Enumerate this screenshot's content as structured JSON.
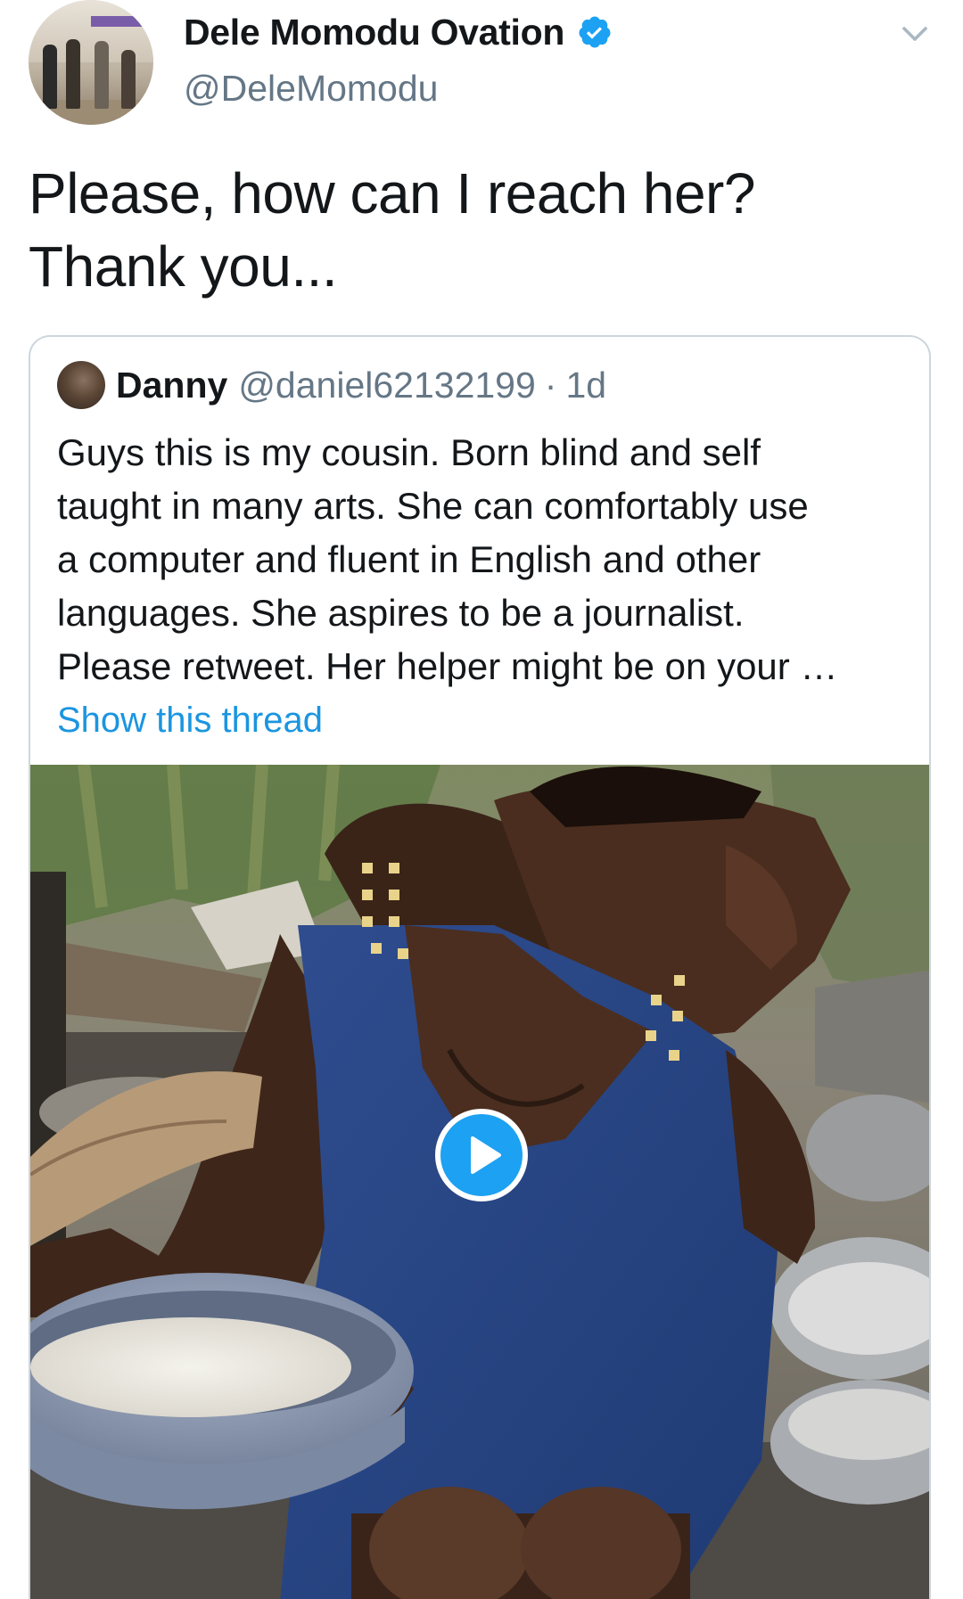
{
  "author": {
    "display_name": "Dele Momodu Ovation",
    "handle": "@DeleMomodu",
    "verified": true,
    "avatar_icon": "profile-photo-group-avatar",
    "verified_icon": "verified-badge-icon",
    "menu_icon": "chevron-down-icon"
  },
  "tweet": {
    "text_lines": [
      "Please, how can I reach her?",
      "Thank you..."
    ]
  },
  "quoted_tweet": {
    "display_name": "Danny",
    "handle": "@daniel62132199",
    "separator": "·",
    "time": "1d",
    "body_lines": [
      "Guys this is my cousin. Born blind and self",
      "taught in many arts. She can comfortably use",
      "a computer and fluent in English and other",
      "languages. She aspires to be a journalist.",
      "Please retweet. Her helper might be on your …"
    ],
    "show_thread_label": "Show this thread",
    "media": {
      "type": "video",
      "play_icon": "play-icon"
    }
  },
  "colors": {
    "text_primary": "#14171a",
    "text_secondary": "#657786",
    "link": "#1b95e0",
    "accent": "#1da1f2",
    "border": "#ccd6dd"
  }
}
